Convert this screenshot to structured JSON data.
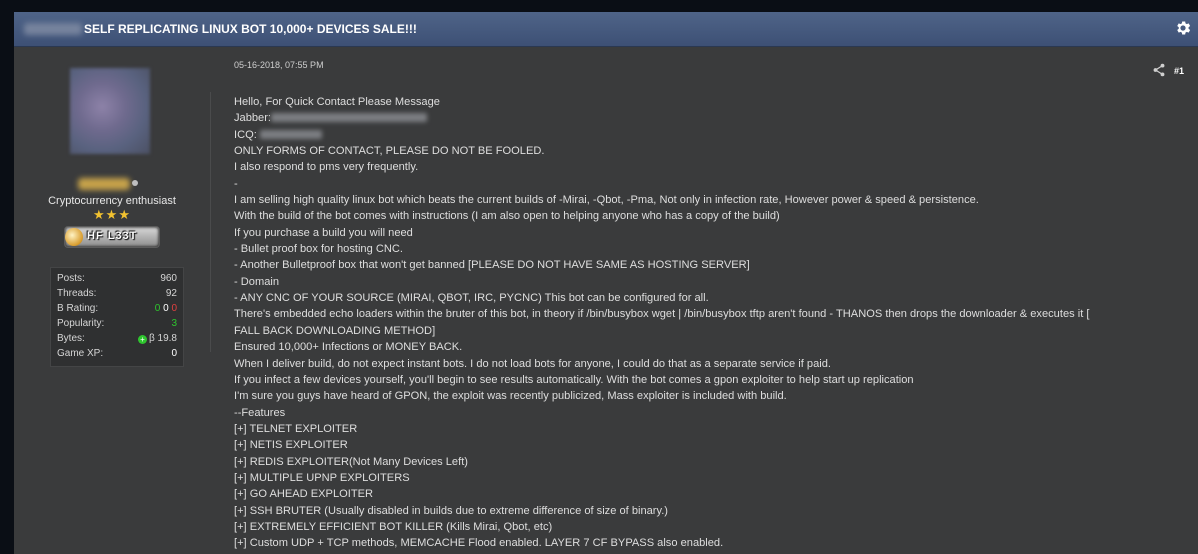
{
  "thread": {
    "title": "SELF REPLICATING LINUX BOT 10,000+ DEVICES SALE!!!"
  },
  "user": {
    "title": "Cryptocurrency enthusiast",
    "stars": "★★★",
    "badge": "HF L33T",
    "stats": [
      {
        "label": "Posts:",
        "value": "960"
      },
      {
        "label": "Threads:",
        "value": "92"
      },
      {
        "label": "B Rating:",
        "values": [
          "0",
          "0",
          "0"
        ]
      },
      {
        "label": "Popularity:",
        "value": "3"
      },
      {
        "label": "Bytes:",
        "value": "β 19.8"
      },
      {
        "label": "Game XP:",
        "value": "0"
      }
    ],
    "colors": {
      "positive": "#2ec52e",
      "negative": "#e04040",
      "neutral": "#ffffff"
    }
  },
  "post": {
    "date": "05-16-2018, 07:55 PM",
    "number": "#1",
    "lines": [
      "Hello, For Quick Contact Please Message",
      "Jabber:",
      "ICQ:",
      "ONLY FORMS OF CONTACT, PLEASE DO NOT BE FOOLED.",
      "I also respond to pms very frequently.",
      "-",
      "I am selling high quality linux bot which beats the current builds of -Mirai, -Qbot, -Pma, Not only in infection rate, However power & speed & persistence.",
      "With the build of the bot comes with instructions (I am also open to helping anyone who has  a copy of the build)",
      "If you purchase a build you will need",
      "- Bullet proof box for hosting CNC.",
      "- Another Bulletproof box that won't get banned [PLEASE DO NOT HAVE SAME AS HOSTING SERVER]",
      "- Domain",
      "- ANY CNC OF YOUR SOURCE (MIRAI, QBOT, IRC, PYCNC) This bot can be configured for all.",
      "There's embedded echo loaders within the bruter of this bot, in theory if /bin/busybox wget | /bin/busybox tftp aren't found - THANOS then drops the downloader & executes it [",
      "FALL BACK DOWNLOADING METHOD]",
      "Ensured 10,000+ Infections or MONEY BACK.",
      "When I deliver build, do not expect instant bots. I do not load bots for anyone, I could do that as a separate service if paid.",
      "If you infect a few devices yourself, you'll begin to see results automatically. With the bot comes a gpon exploiter to help start up replication",
      "I'm sure you guys have heard of GPON, the exploit was recently publicized, Mass exploiter is included with build.",
      "--Features",
      "[+] TELNET EXPLOITER",
      "[+] NETIS EXPLOITER",
      "[+] REDIS EXPLOITER(Not Many Devices Left)",
      "[+] MULTIPLE UPNP EXPLOITERS",
      "[+] GO AHEAD EXPLOITER",
      "[+] SSH BRUTER (Usually disabled in builds due to extreme difference of size of binary.)",
      "[+] EXTREMELY EFFICIENT BOT KILLER (Kills Mirai, Qbot, etc)",
      "[+] Custom UDP + TCP methods, MEMCACHE Flood enabled. LAYER 7 CF BYPASS also enabled."
    ]
  },
  "icons": {
    "settings": "gear-icon",
    "share": "share-icon",
    "online": "online-status-icon",
    "bytes": "bytes-plus-icon"
  }
}
